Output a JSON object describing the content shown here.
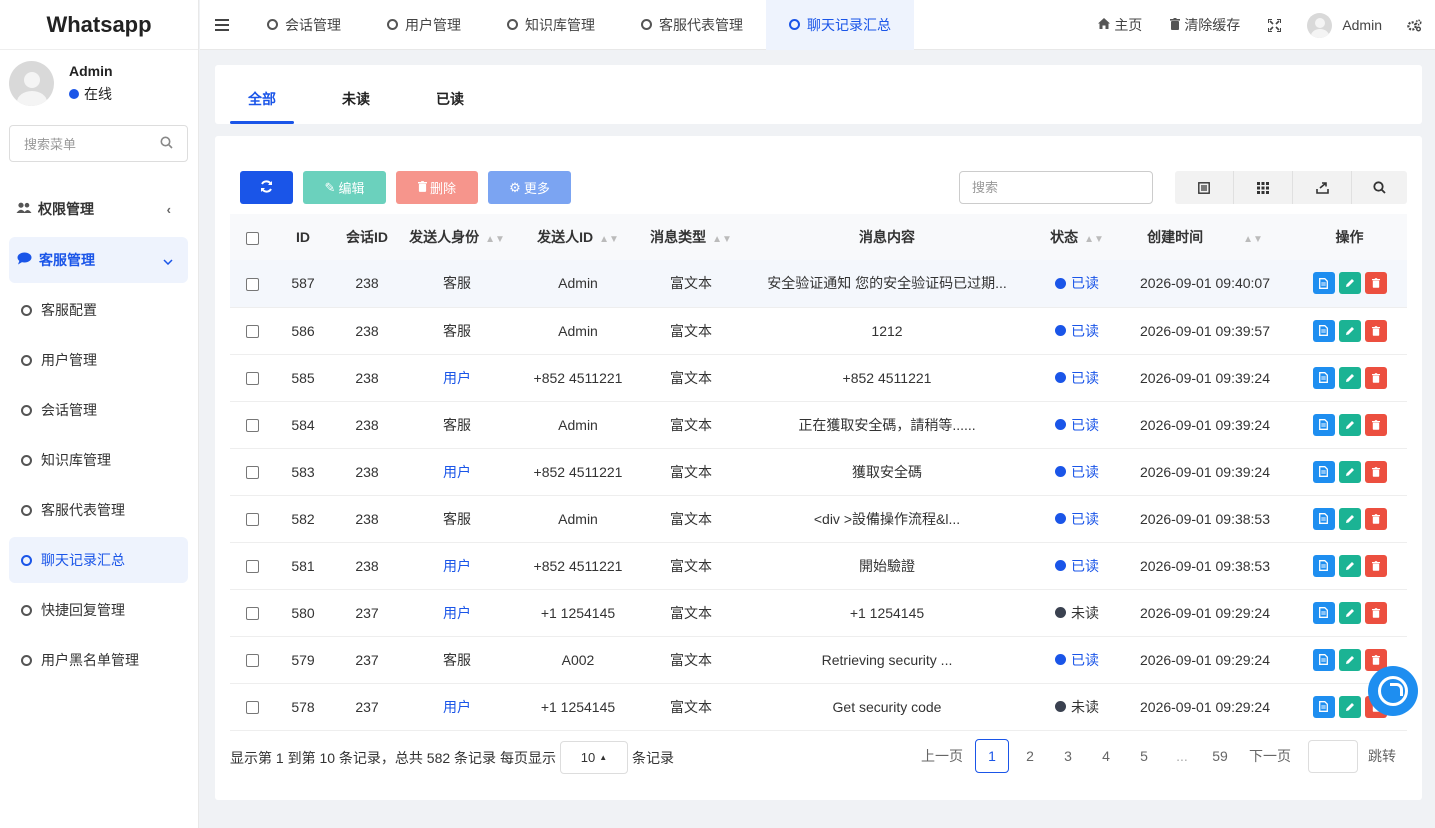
{
  "app": {
    "title": "Whatsapp"
  },
  "sidebar": {
    "user": {
      "name": "Admin",
      "status": "在线"
    },
    "search_placeholder": "搜索菜单",
    "groups": [
      {
        "label": "权限管理"
      },
      {
        "label": "客服管理"
      }
    ],
    "items": [
      {
        "label": "客服配置"
      },
      {
        "label": "用户管理"
      },
      {
        "label": "会话管理"
      },
      {
        "label": "知识库管理"
      },
      {
        "label": "客服代表管理"
      },
      {
        "label": "聊天记录汇总"
      },
      {
        "label": "快捷回复管理"
      },
      {
        "label": "用户黑名单管理"
      }
    ]
  },
  "topbar": {
    "tabs": [
      {
        "label": "会话管理"
      },
      {
        "label": "用户管理"
      },
      {
        "label": "知识库管理"
      },
      {
        "label": "客服代表管理"
      },
      {
        "label": "聊天记录汇总"
      }
    ],
    "home": "主页",
    "clear_cache": "清除缓存",
    "user": "Admin"
  },
  "filter_tabs": [
    {
      "label": "全部"
    },
    {
      "label": "未读"
    },
    {
      "label": "已读"
    }
  ],
  "toolbar": {
    "edit": "编辑",
    "delete": "删除",
    "more": "更多",
    "search_placeholder": "搜索"
  },
  "table": {
    "headers": [
      "ID",
      "会话ID",
      "发送人身份",
      "发送人ID",
      "消息类型",
      "消息内容",
      "状态",
      "创建时间",
      "操作"
    ],
    "rows": [
      {
        "id": "587",
        "session": "238",
        "role": "客服",
        "sender": "Admin",
        "type": "富文本",
        "content": "安全验证通知 您的安全验证码已过期...",
        "status": "已读",
        "time": "2026-09-01 09:40:07"
      },
      {
        "id": "586",
        "session": "238",
        "role": "客服",
        "sender": "Admin",
        "type": "富文本",
        "content": "1212",
        "status": "已读",
        "time": "2026-09-01 09:39:57"
      },
      {
        "id": "585",
        "session": "238",
        "role": "用户",
        "sender": "+852 4511221",
        "type": "富文本",
        "content": "+852 4511221",
        "status": "已读",
        "time": "2026-09-01 09:39:24"
      },
      {
        "id": "584",
        "session": "238",
        "role": "客服",
        "sender": "Admin",
        "type": "富文本",
        "content": "正在獲取安全碼，請稍等......",
        "status": "已读",
        "time": "2026-09-01 09:39:24"
      },
      {
        "id": "583",
        "session": "238",
        "role": "用户",
        "sender": "+852 4511221",
        "type": "富文本",
        "content": "獲取安全碼",
        "status": "已读",
        "time": "2026-09-01 09:39:24"
      },
      {
        "id": "582",
        "session": "238",
        "role": "客服",
        "sender": "Admin",
        "type": "富文本",
        "content": "<div >設備操作流程&l...",
        "status": "已读",
        "time": "2026-09-01 09:38:53"
      },
      {
        "id": "581",
        "session": "238",
        "role": "用户",
        "sender": "+852 4511221",
        "type": "富文本",
        "content": "開始驗證",
        "status": "已读",
        "time": "2026-09-01 09:38:53"
      },
      {
        "id": "580",
        "session": "237",
        "role": "用户",
        "sender": "+1 1254145",
        "type": "富文本",
        "content": "+1 1254145",
        "status": "未读",
        "time": "2026-09-01 09:29:24"
      },
      {
        "id": "579",
        "session": "237",
        "role": "客服",
        "sender": "A002",
        "type": "富文本",
        "content": "Retrieving security ...",
        "status": "已读",
        "time": "2026-09-01 09:29:24"
      },
      {
        "id": "578",
        "session": "237",
        "role": "用户",
        "sender": "+1 1254145",
        "type": "富文本",
        "content": "Get security code",
        "status": "未读",
        "time": "2026-09-01 09:29:24"
      }
    ]
  },
  "pagination": {
    "info": "显示第 1 到第 10 条记录，总共 582 条记录 每页显示",
    "page_size": "10",
    "suffix": "条记录",
    "prev": "上一页",
    "pages": [
      "1",
      "2",
      "3",
      "4",
      "5",
      "...",
      "59"
    ],
    "next": "下一页",
    "jump": "跳转"
  },
  "colors": {
    "accent": "#1a55e8",
    "edit": "#6bd1bd",
    "delete": "#f6958c",
    "more": "#7ba4f2"
  }
}
